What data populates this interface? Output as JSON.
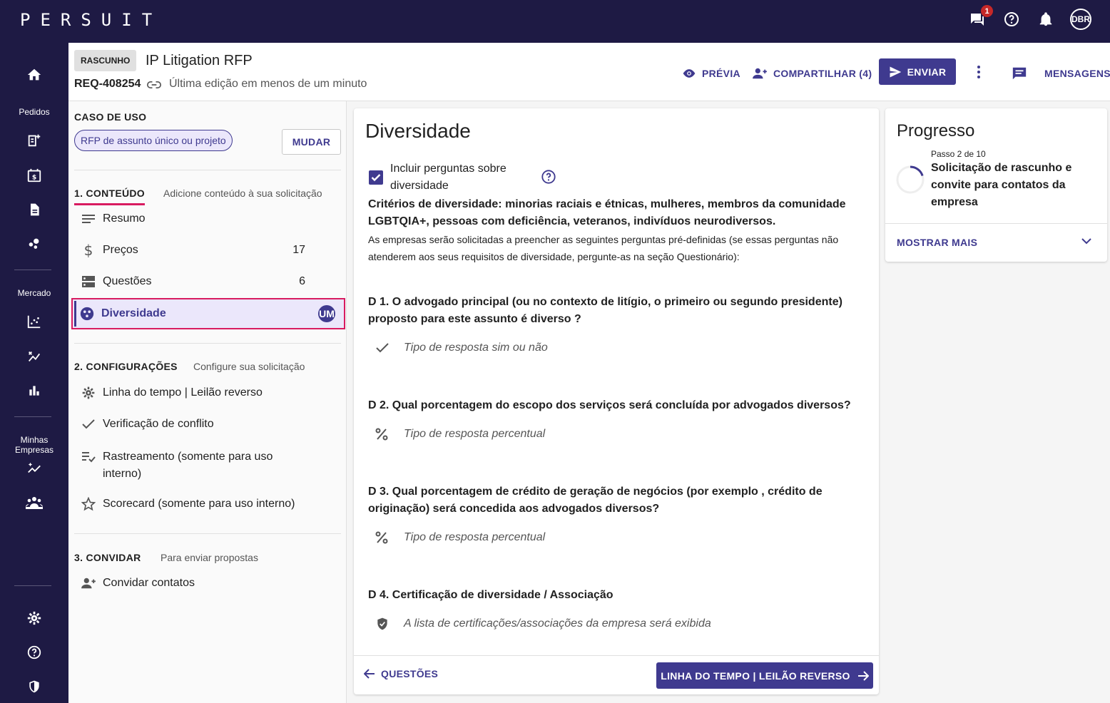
{
  "app": {
    "logo": "PERSUIT",
    "notifications_count": "1",
    "user_initials": "DBR"
  },
  "rail": {
    "orders_label": "Pedidos",
    "market_label": "Mercado",
    "firms_label": "Minhas Empresas"
  },
  "header": {
    "status_chip": "RASCUNHO",
    "title": "IP Litigation RFP",
    "req_id": "REQ-408254",
    "last_edit": "Última edição em menos de um minuto",
    "preview_label": "PRÉVIA",
    "share_label": "COMPARTILHAR (4)",
    "send_label": "ENVIAR",
    "messages_label": "MENSAGENS"
  },
  "leftnav": {
    "usecase_title": "CASO DE USO",
    "usecase_chip": "RFP de assunto único ou projeto",
    "change_label": "MUDAR",
    "content_title": "1. CONTEÚDO",
    "content_sub": "Adicione conteúdo à sua solicitação",
    "content_items": [
      {
        "label": "Resumo",
        "count": ""
      },
      {
        "label": "Preços",
        "count": "17"
      },
      {
        "label": "Questões",
        "count": "6"
      },
      {
        "label": "Diversidade",
        "count": ""
      }
    ],
    "active_avatar": "UM",
    "config_title": "2. CONFIGURAÇÕES",
    "config_sub": "Configure sua solicitação",
    "config_items": [
      {
        "label": "Linha do tempo | Leilão reverso"
      },
      {
        "label": "Verificação de conflito"
      },
      {
        "label": "Rastreamento (somente para uso interno)"
      },
      {
        "label": "Scorecard (somente para uso interno)"
      }
    ],
    "invite_title": "3. CONVIDAR",
    "invite_sub": "Para enviar propostas",
    "invite_items": [
      {
        "label": "Convidar contatos"
      }
    ]
  },
  "main": {
    "title": "Diversidade",
    "include_label": "Incluir perguntas sobre diversidade",
    "criteria": "Critérios de diversidade: minorias raciais e étnicas, mulheres, membros da comunidade LGBTQIA+, pessoas com deficiência, veteranos, indivíduos neurodiversos.",
    "description": "As empresas serão solicitadas a preencher as seguintes perguntas pré-definidas (se essas perguntas não atenderem aos seus requisitos de diversidade, pergunte-as na seção Questionário):",
    "questions": [
      {
        "title": "D 1. O advogado principal (ou no contexto de litígio, o primeiro ou segundo presidente) proposto para este assunto é diverso ?",
        "answer": "Tipo de resposta sim ou não",
        "icon": "check-icon"
      },
      {
        "title": "D 2. Qual porcentagem do escopo dos serviços será concluída por advogados diversos?",
        "answer": "Tipo de resposta percentual",
        "icon": "percent-icon"
      },
      {
        "title": "D 3. Qual porcentagem de crédito de geração de negócios (por exemplo , crédito de originação) será concedida aos advogados diversos?",
        "answer": "Tipo de resposta percentual",
        "icon": "percent-icon"
      },
      {
        "title": "D 4. Certificação de diversidade / Associação",
        "answer": "A lista de certificações/associações da empresa será exibida",
        "icon": "shield-check-icon"
      }
    ],
    "back_label": "QUESTÕES",
    "next_label": "LINHA DO TEMPO | LEILÃO REVERSO"
  },
  "progress": {
    "title": "Progresso",
    "step_of": "Passo 2 de 10",
    "step_name": "Solicitação de rascunho e convite para contatos da empresa",
    "show_more": "MOSTRAR MAIS",
    "fraction": 0.2
  },
  "colors": {
    "primary": "#3f3a8f",
    "nav_bg": "#1e1a44",
    "highlight": "#d81b60",
    "active_bg": "#ebe7fb"
  }
}
